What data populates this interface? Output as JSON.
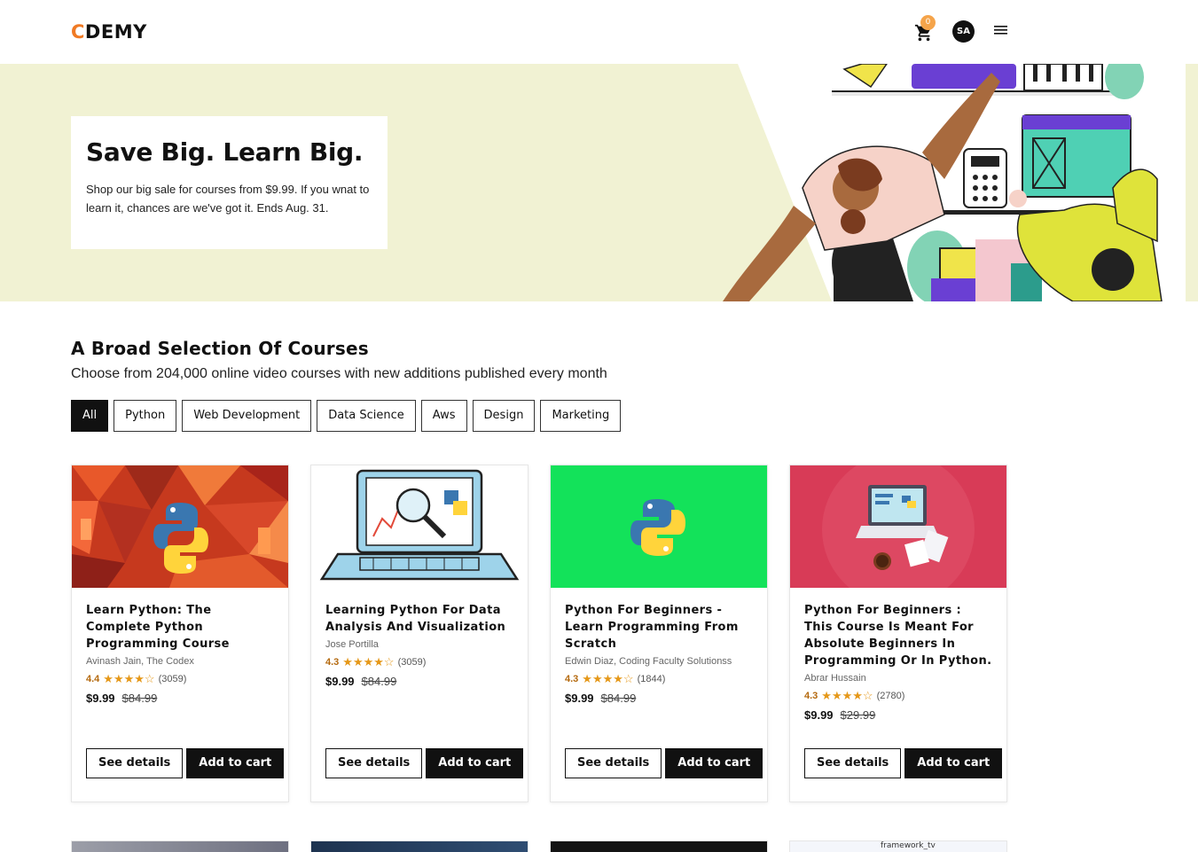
{
  "brand": {
    "logo_first": "C",
    "logo_rest": "DEMY",
    "accent": "#f07a24"
  },
  "navbar": {
    "cart_count": "0",
    "avatar_initials": "SA",
    "cart_icon": "cart-icon",
    "menu_icon": "hamburger-icon"
  },
  "hero": {
    "title": "Save Big. Learn Big.",
    "text": "Shop our big sale for courses from $9.99. If you wnat to learn it, chances are we've got it. Ends Aug. 31.",
    "background": "#f1f2d3"
  },
  "section": {
    "title": "A Broad Selection Of Courses",
    "subtitle": "Choose from 204,000 online video courses with new additions published every month"
  },
  "filters": [
    {
      "label": "All",
      "active": true
    },
    {
      "label": "Python",
      "active": false
    },
    {
      "label": "Web Development",
      "active": false
    },
    {
      "label": "Data Science",
      "active": false
    },
    {
      "label": "Aws",
      "active": false
    },
    {
      "label": "Design",
      "active": false
    },
    {
      "label": "Marketing",
      "active": false
    }
  ],
  "courses": [
    {
      "title": "Learn Python: The Complete Python Programming Course",
      "instructor": "Avinash Jain, The Codex",
      "rating": "4.4",
      "stars": "★★★★☆",
      "reviews": "(3059)",
      "price": "$9.99",
      "old_price": "$84.99"
    },
    {
      "title": "Learning Python For Data Analysis And Visualization",
      "instructor": "Jose Portilla",
      "rating": "4.3",
      "stars": "★★★★☆",
      "reviews": "(3059)",
      "price": "$9.99",
      "old_price": "$84.99"
    },
    {
      "title": "Python For Beginners - Learn Programming From Scratch",
      "instructor": "Edwin Diaz, Coding Faculty Solutionss",
      "rating": "4.3",
      "stars": "★★★★☆",
      "reviews": "(1844)",
      "price": "$9.99",
      "old_price": "$84.99"
    },
    {
      "title": "Python For Beginners : This Course Is Meant For Absolute Beginners In Programming Or In Python.",
      "instructor": "Abrar Hussain",
      "rating": "4.3",
      "stars": "★★★★☆",
      "reviews": "(2780)",
      "price": "$9.99",
      "old_price": "$29.99"
    }
  ],
  "card_actions": {
    "details_label": "See details",
    "cart_label": "Add to cart"
  },
  "row2_peek": {
    "last_label": "framework_tv"
  }
}
